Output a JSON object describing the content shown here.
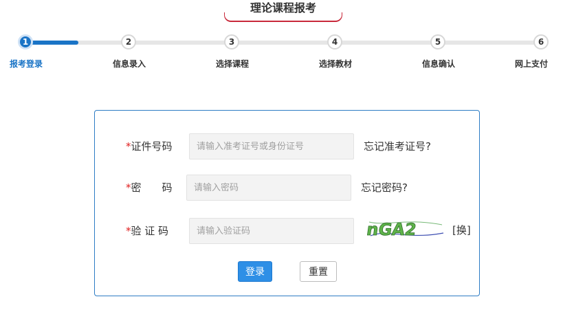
{
  "header": {
    "title": "理论课程报考"
  },
  "steps": [
    {
      "number": "1",
      "label": "报考登录",
      "active": true
    },
    {
      "number": "2",
      "label": "信息录入",
      "active": false
    },
    {
      "number": "3",
      "label": "选择课程",
      "active": false
    },
    {
      "number": "4",
      "label": "选择教材",
      "active": false
    },
    {
      "number": "5",
      "label": "信息确认",
      "active": false
    },
    {
      "number": "6",
      "label": "网上支付",
      "active": false
    }
  ],
  "form": {
    "required_mark": "*",
    "id_label": "证件号码",
    "id_placeholder": "请输入准考证号或身份证号",
    "id_value": "",
    "forgot_id": "忘记准考证号?",
    "password_label": "密　　码",
    "password_placeholder": "请输入密码",
    "password_value": "",
    "forgot_password": "忘记密码?",
    "captcha_label": "验 证 码",
    "captcha_placeholder": "请输入验证码",
    "captcha_value": "",
    "captcha_image_text": "nGA2",
    "captcha_swap": "[换]",
    "login_button": "登录",
    "reset_button": "重置"
  },
  "colors": {
    "accent": "#1a74c6",
    "required": "#e02020",
    "title_underline": "#c8283a",
    "login_button_bg": "#2e8fe6"
  }
}
